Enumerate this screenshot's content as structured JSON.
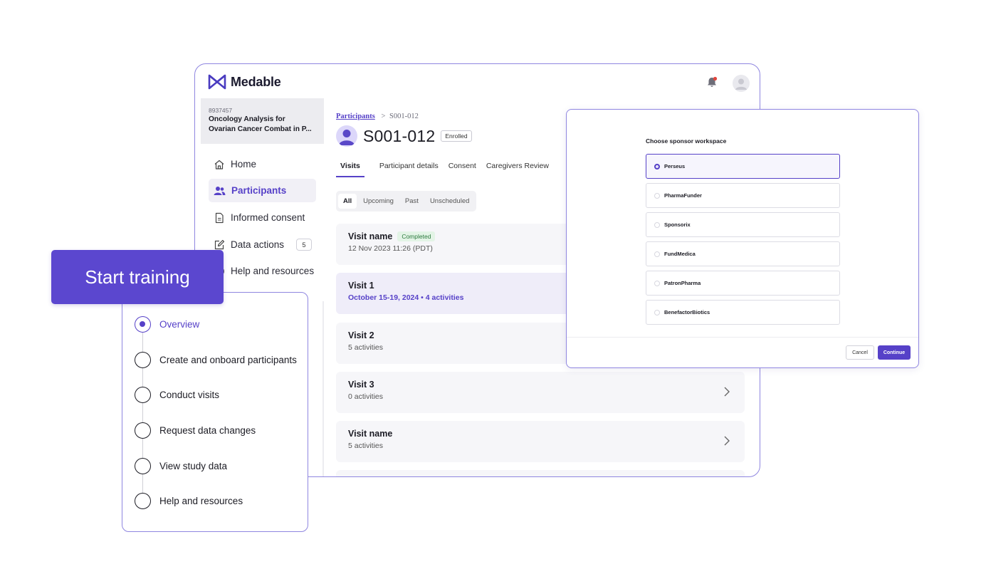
{
  "app": {
    "brand": "Medable",
    "study": {
      "id": "8937457",
      "name_line1": "Oncology Analysis for",
      "name_line2": "Ovarian Cancer Combat in P..."
    },
    "nav": [
      {
        "label": "Home",
        "icon": "home-icon"
      },
      {
        "label": "Participants",
        "icon": "users-icon",
        "active": true
      },
      {
        "label": "Informed consent",
        "icon": "document-icon"
      },
      {
        "label": "Data actions",
        "icon": "edit-icon",
        "badge": "5"
      },
      {
        "label": "Help and resources",
        "icon": "help-icon"
      }
    ],
    "breadcrumb": {
      "link": "Participants",
      "separator": ">",
      "current": "S001-012"
    },
    "participant": {
      "id": "S001-012",
      "status": "Enrolled"
    },
    "tabs": [
      "Visits",
      "Participant details",
      "Consent",
      "Caregivers Review"
    ],
    "filters": [
      "All",
      "Upcoming",
      "Past",
      "Unscheduled"
    ],
    "visits": [
      {
        "title": "Visit name",
        "badge": "Completed",
        "subtitle": "12 Nov 2023 11:26 (PDT)"
      },
      {
        "title": "Visit 1",
        "subtitle": "October 15-19, 2024  • 4 activities"
      },
      {
        "title": "Visit 2",
        "subtitle": "5 activities"
      },
      {
        "title": "Visit 3",
        "subtitle": "0 activities"
      },
      {
        "title": "Visit name",
        "subtitle": "5 activities"
      }
    ]
  },
  "modal": {
    "title": "Choose sponsor workspace",
    "options": [
      "Perseus",
      "PharmaFunder",
      "Sponsorix",
      "FundMedica",
      "PatronPharma",
      "BenefactorBiotics"
    ],
    "selected": "Perseus",
    "cancel_label": "Cancel",
    "continue_label": "Continue"
  },
  "training": {
    "start_label": "Start training",
    "steps": [
      "Overview",
      "Create and onboard participants",
      "Conduct visits",
      "Request data changes",
      "View study data",
      "Help and resources"
    ],
    "active_step": "Overview"
  },
  "colors": {
    "accent": "#5641c8",
    "button": "#5b47cf",
    "border": "#8f86e0",
    "completed_bg": "#e3f4e6",
    "completed_text": "#2c7a3e"
  }
}
